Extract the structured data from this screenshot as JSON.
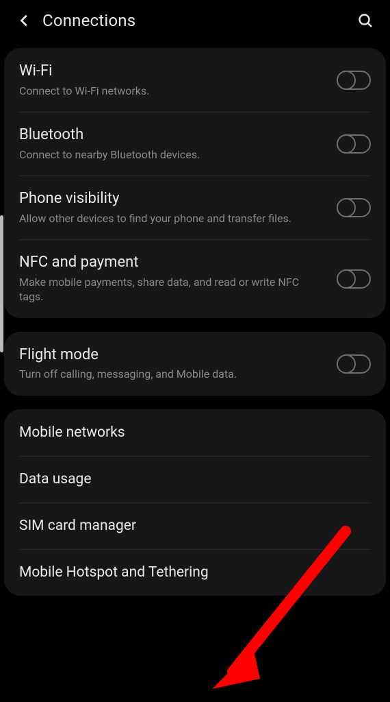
{
  "header": {
    "title": "Connections"
  },
  "groups": [
    {
      "rows": [
        {
          "key": "wifi",
          "title": "Wi-Fi",
          "sub": "Connect to Wi-Fi networks.",
          "toggle": true
        },
        {
          "key": "bluetooth",
          "title": "Bluetooth",
          "sub": "Connect to nearby Bluetooth devices.",
          "toggle": true
        },
        {
          "key": "phone-visibility",
          "title": "Phone visibility",
          "sub": "Allow other devices to find your phone and transfer files.",
          "toggle": true
        },
        {
          "key": "nfc-payment",
          "title": "NFC and payment",
          "sub": "Make mobile payments, share data, and read or write NFC tags.",
          "toggle": true
        }
      ]
    },
    {
      "rows": [
        {
          "key": "flight-mode",
          "title": "Flight mode",
          "sub": "Turn off calling, messaging, and Mobile data.",
          "toggle": true
        }
      ]
    },
    {
      "rows": [
        {
          "key": "mobile-networks",
          "title": "Mobile networks",
          "toggle": false
        },
        {
          "key": "data-usage",
          "title": "Data usage",
          "toggle": false
        },
        {
          "key": "sim-card-manager",
          "title": "SIM card manager",
          "toggle": false
        },
        {
          "key": "mobile-hotspot-tethering",
          "title": "Mobile Hotspot and Tethering",
          "toggle": false
        }
      ]
    }
  ]
}
